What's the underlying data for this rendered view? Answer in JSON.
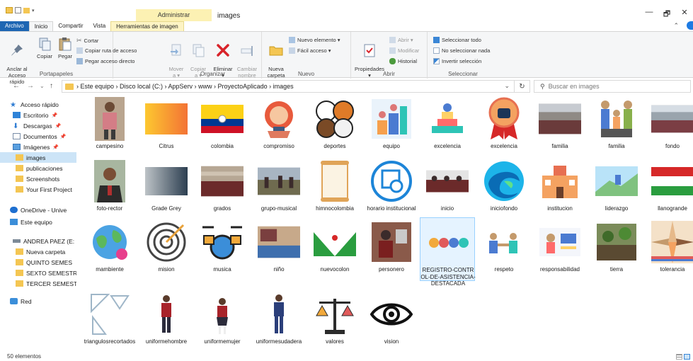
{
  "window": {
    "title": "images",
    "context_group": "Administrar",
    "minimize": "—",
    "maximize": "🗗",
    "close": "✕"
  },
  "ribbon_tabs": [
    "Archivo",
    "Inicio",
    "Compartir",
    "Vista",
    "Herramientas de imagen"
  ],
  "ribbon": {
    "portapapeles": {
      "label": "Portapapeles",
      "pin": "Anclar al\nAcceso rápido",
      "copy": "Copiar",
      "paste": "Pegar",
      "cut": "Cortar",
      "copy_path": "Copiar ruta de acceso",
      "paste_shortcut": "Pegar acceso directo"
    },
    "organizar": {
      "label": "Organizar",
      "move": "Mover\na ▾",
      "copy_to": "Copiar\na ▾",
      "delete": "Eliminar\n▾",
      "rename": "Cambiar\nnombre"
    },
    "nuevo": {
      "label": "Nuevo",
      "new_folder": "Nueva\ncarpeta",
      "new_item": "Nuevo elemento ▾",
      "easy_access": "Fácil acceso ▾"
    },
    "abrir": {
      "label": "Abrir",
      "properties": "Propiedades\n▾",
      "open": "Abrir ▾",
      "edit": "Modificar",
      "history": "Historial"
    },
    "seleccionar": {
      "label": "Seleccionar",
      "select_all": "Seleccionar todo",
      "select_none": "No seleccionar nada",
      "invert": "Invertir selección"
    }
  },
  "nav": {
    "back": "←",
    "forward": "→",
    "dropdown": "⌄",
    "up": "↑",
    "breadcrumb": "›  Este equipo  ›  Disco local (C:)  ›  AppServ  ›  www  ›  ProyectoAplicado  ›  images",
    "history_dropdown": "⌄",
    "refresh": "↻",
    "search_placeholder": "Buscar en images"
  },
  "sidebar": [
    {
      "label": "Acceso rápido",
      "icon": "star-icon",
      "pin": ""
    },
    {
      "label": "Escritorio",
      "icon": "desktop-icon",
      "pin": "📌"
    },
    {
      "label": "Descargas",
      "icon": "download-icon",
      "pin": "📌"
    },
    {
      "label": "Documentos",
      "icon": "document-icon",
      "pin": "📌"
    },
    {
      "label": "Imágenes",
      "icon": "pictures-icon",
      "pin": "📌"
    },
    {
      "label": "images",
      "icon": "folder-icon",
      "pin": ""
    },
    {
      "label": "publicaciones",
      "icon": "folder-icon",
      "pin": ""
    },
    {
      "label": "Screenshots",
      "icon": "folder-icon",
      "pin": ""
    },
    {
      "label": "Your First Project",
      "icon": "folder-icon",
      "pin": ""
    },
    {
      "label": "OneDrive - Unive",
      "icon": "cloud-icon",
      "pin": ""
    },
    {
      "label": "Este equipo",
      "icon": "computer-icon",
      "pin": ""
    },
    {
      "label": "ANDREA PAEZ (E:",
      "icon": "drive-icon",
      "pin": ""
    },
    {
      "label": "Nueva carpeta",
      "icon": "folder-icon",
      "pin": ""
    },
    {
      "label": "QUINTO SEMES",
      "icon": "folder-icon",
      "pin": ""
    },
    {
      "label": "SEXTO SEMESTR",
      "icon": "folder-icon",
      "pin": ""
    },
    {
      "label": "TERCER SEMEST",
      "icon": "folder-icon",
      "pin": ""
    },
    {
      "label": "Red",
      "icon": "network-icon",
      "pin": ""
    }
  ],
  "files": [
    {
      "name": "campesino",
      "icon": "photo-person-icon"
    },
    {
      "name": "Citrus",
      "icon": "gradient-orange-icon"
    },
    {
      "name": "colombia",
      "icon": "flag-colombia-icon"
    },
    {
      "name": "compromiso",
      "icon": "commitment-badge-icon"
    },
    {
      "name": "deportes",
      "icon": "sports-balls-icon"
    },
    {
      "name": "equipo",
      "icon": "team-icon"
    },
    {
      "name": "excelencia",
      "icon": "excellence-icon"
    },
    {
      "name": "excelencia",
      "icon": "medal-thumb-icon"
    },
    {
      "name": "familia",
      "icon": "photo-crowd-icon"
    },
    {
      "name": "familia",
      "icon": "family-icon"
    },
    {
      "name": "fondo",
      "icon": "photo-landscape-icon"
    },
    {
      "name": "foto-rector",
      "icon": "photo-portrait-icon"
    },
    {
      "name": "Grade Grey",
      "icon": "gradient-grey-icon"
    },
    {
      "name": "grados",
      "icon": "photo-group-icon"
    },
    {
      "name": "grupo-musical",
      "icon": "photo-band-icon"
    },
    {
      "name": "himnocolombia",
      "icon": "scroll-icon"
    },
    {
      "name": "horario institucional",
      "icon": "calendar-clock-icon"
    },
    {
      "name": "inicio",
      "icon": "photo-students-icon"
    },
    {
      "name": "iniciofondo",
      "icon": "edge-logo-icon"
    },
    {
      "name": "institucion",
      "icon": "school-building-icon"
    },
    {
      "name": "liderazgo",
      "icon": "leadership-icon"
    },
    {
      "name": "llanogrande",
      "icon": "flag-tricolor-icon"
    },
    {
      "name": "mambiente",
      "icon": "environment-globe-icon"
    },
    {
      "name": "mision",
      "icon": "target-icon"
    },
    {
      "name": "musica",
      "icon": "drum-kit-icon"
    },
    {
      "name": "niño",
      "icon": "photo-child-icon"
    },
    {
      "name": "nuevocolon",
      "icon": "flag-green-icon"
    },
    {
      "name": "personero",
      "icon": "photo-personero-icon"
    },
    {
      "name": "REGISTRO-CONTROL-DE-ASISTENCIA-DESTACADA",
      "icon": "attendance-icon"
    },
    {
      "name": "respeto",
      "icon": "respect-icon"
    },
    {
      "name": "responsabilidad",
      "icon": "responsibility-icon"
    },
    {
      "name": "tierra",
      "icon": "photo-garden-icon"
    },
    {
      "name": "tolerancia",
      "icon": "hands-icon"
    },
    {
      "name": "triangulosrecortados",
      "icon": "triangles-pattern-icon"
    },
    {
      "name": "uniformehombre",
      "icon": "uniform-boy-icon"
    },
    {
      "name": "uniformemujer",
      "icon": "uniform-girl-icon"
    },
    {
      "name": "uniformesudadera",
      "icon": "uniform-tracksuit-icon"
    },
    {
      "name": "valores",
      "icon": "scales-icon"
    },
    {
      "name": "vision",
      "icon": "eye-icon"
    }
  ],
  "status": {
    "count": "50 elementos"
  },
  "colors": {
    "accent": "#1e66b3",
    "selection": "#cce4f7",
    "context_tab": "#fcf1b3",
    "folder": "#f4c653"
  }
}
